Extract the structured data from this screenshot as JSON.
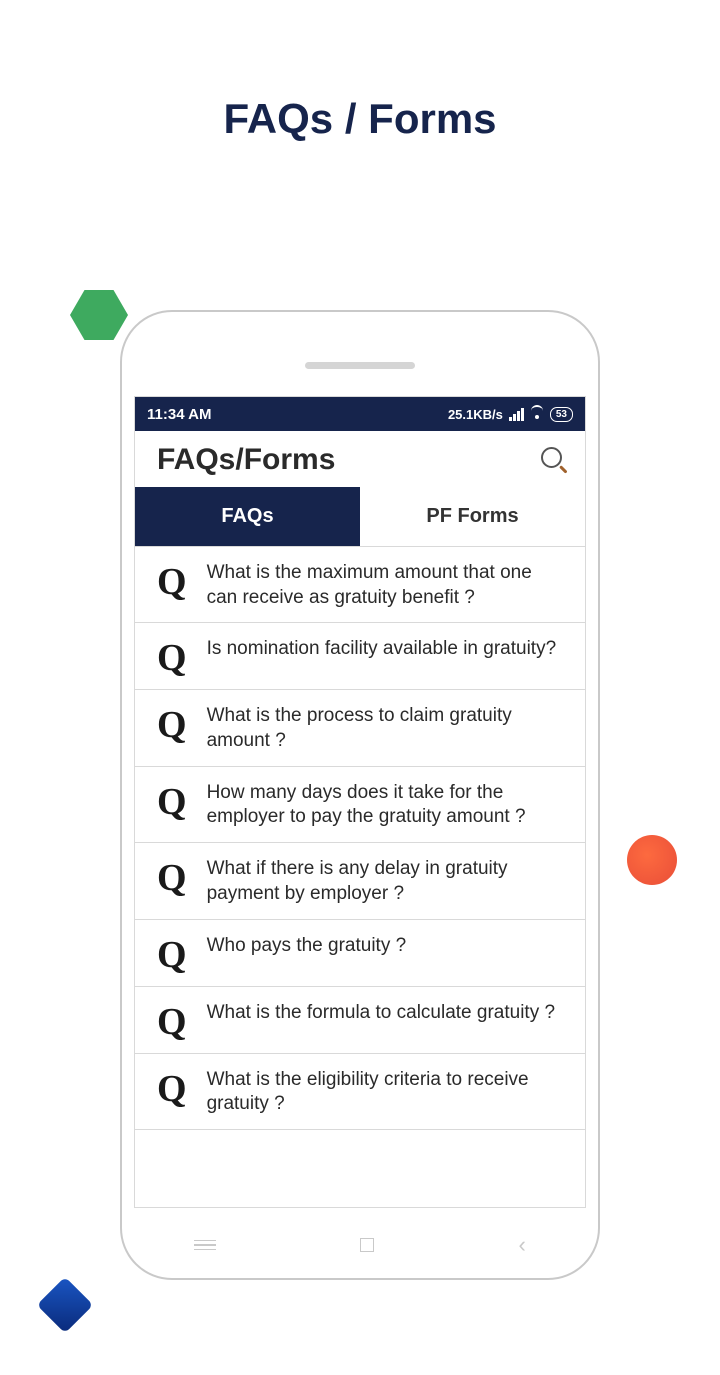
{
  "page_heading": "FAQs / Forms",
  "statusbar": {
    "time": "11:34 AM",
    "speed": "25.1KB/s",
    "battery": "53"
  },
  "header": {
    "title": "FAQs/Forms"
  },
  "tabs": {
    "faqs": "FAQs",
    "pfforms": "PF Forms"
  },
  "q_glyph": "Q",
  "faqs": [
    {
      "text": "What is the maximum amount that one can receive as gratuity benefit ?"
    },
    {
      "text": "Is nomination facility available in gratuity?"
    },
    {
      "text": "What is the process to claim gratuity amount ?"
    },
    {
      "text": "How many days does it take for the employer to pay the gratuity amount ?"
    },
    {
      "text": "What if there is any delay in gratuity payment by employer ?"
    },
    {
      "text": "Who pays the gratuity ?"
    },
    {
      "text": "What is the formula to calculate gratuity ?"
    },
    {
      "text": "What is the eligibility criteria to receive gratuity ?"
    }
  ]
}
